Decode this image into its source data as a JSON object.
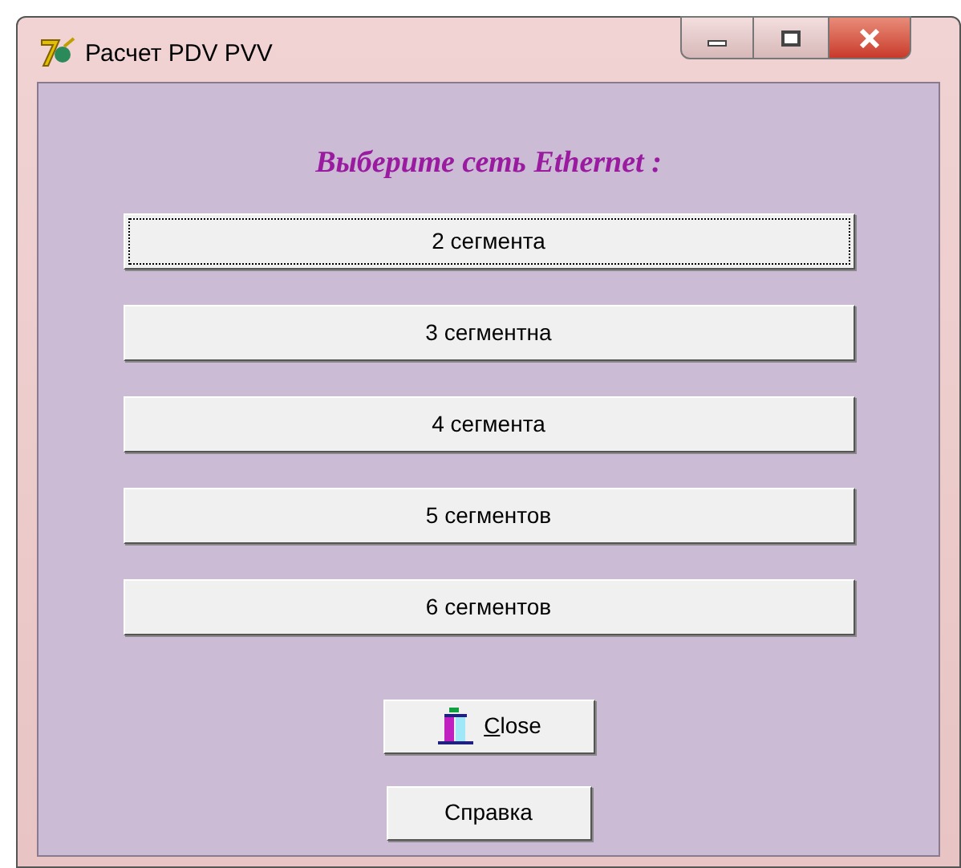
{
  "window": {
    "title": "Расчет PDV PVV"
  },
  "heading": "Выберите сеть Ethernet :",
  "options": [
    {
      "label": "2 сегмента",
      "focused": true
    },
    {
      "label": "3 сегментна",
      "focused": false
    },
    {
      "label": "4 сегмента",
      "focused": false
    },
    {
      "label": "5 сегментов",
      "focused": false
    },
    {
      "label": "6 сегментов",
      "focused": false
    }
  ],
  "close_button": {
    "label_parts": [
      {
        "text": "C",
        "underlined": true
      },
      {
        "text": "lose",
        "underlined": false
      }
    ]
  },
  "help_button": {
    "label": "Справка"
  }
}
